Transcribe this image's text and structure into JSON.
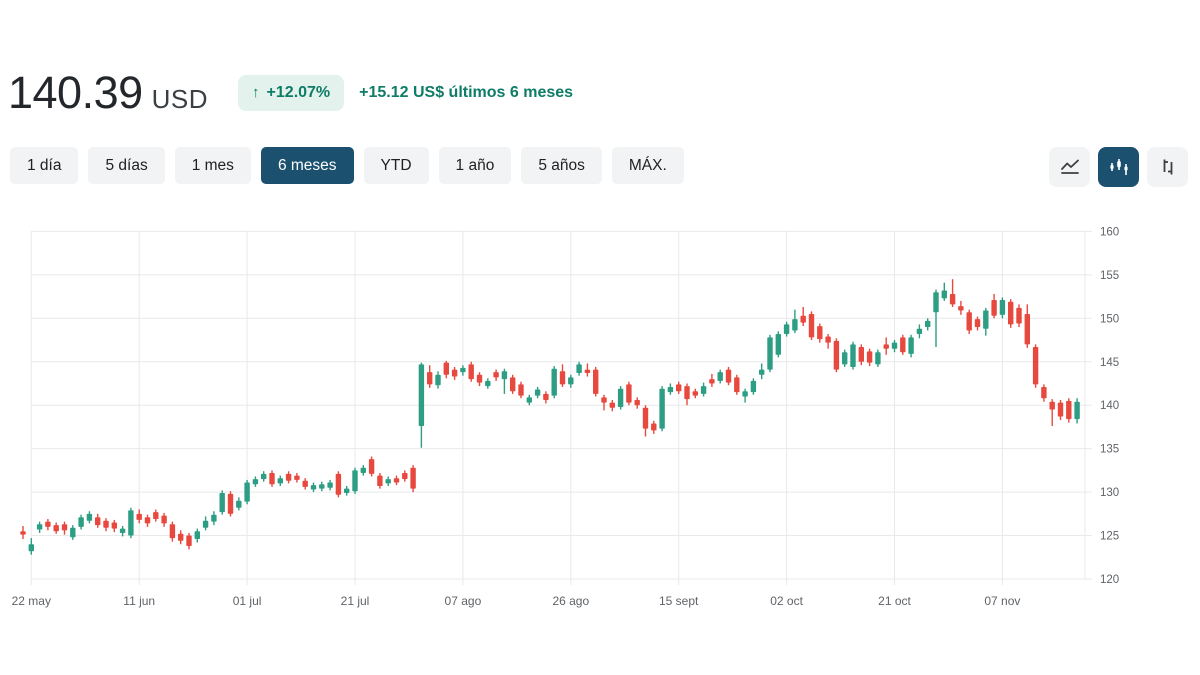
{
  "header": {
    "price": "140.39",
    "currency": "USD",
    "arrow": "↑",
    "change_percent": "+12.07%",
    "change_detail": "+15.12 US$ últimos 6 meses",
    "accent_color": "#0e7c66",
    "badge_bg": "#e3f2ec"
  },
  "tabs": {
    "items": [
      {
        "label": "1 día",
        "selected": false
      },
      {
        "label": "5 días",
        "selected": false
      },
      {
        "label": "1 mes",
        "selected": false
      },
      {
        "label": "6 meses",
        "selected": true
      },
      {
        "label": "YTD",
        "selected": false
      },
      {
        "label": "1 año",
        "selected": false
      },
      {
        "label": "5 años",
        "selected": false
      },
      {
        "label": "MÁX.",
        "selected": false
      }
    ],
    "selected_bg": "#1b506f"
  },
  "chart_controls": {
    "buttons": [
      {
        "icon": "line-chart-icon",
        "selected": false
      },
      {
        "icon": "candlestick-icon",
        "selected": true
      },
      {
        "icon": "ohlc-compare-icon",
        "selected": false
      }
    ]
  },
  "chart_data": {
    "type": "candlestick",
    "title": "",
    "xlabel": "",
    "ylabel": "",
    "ylim": [
      120,
      160
    ],
    "y_ticks": [
      120,
      125,
      130,
      135,
      140,
      145,
      150,
      155,
      160
    ],
    "x_tick_labels": [
      "22 may",
      "11 jun",
      "01 jul",
      "21 jul",
      "07 ago",
      "26 ago",
      "15 sept",
      "02 oct",
      "21 oct",
      "07 nov"
    ],
    "x_tick_indices": [
      1,
      14,
      27,
      40,
      53,
      66,
      79,
      92,
      105,
      118
    ],
    "grid": true,
    "legend": "none",
    "up_color": "#2d9e84",
    "down_color": "#e8493f",
    "axis_text_color": "#5f6368",
    "grid_color": "#e8e9eb",
    "candles_format": "[open, high, low, close]",
    "candles": [
      [
        125.5,
        126.1,
        124.6,
        125.1
      ],
      [
        123.2,
        124.7,
        122.8,
        124.0
      ],
      [
        125.7,
        126.6,
        125.3,
        126.3
      ],
      [
        126.6,
        126.9,
        125.6,
        126.0
      ],
      [
        126.2,
        126.5,
        125.2,
        125.5
      ],
      [
        126.3,
        126.6,
        125.1,
        125.6
      ],
      [
        124.8,
        126.2,
        124.5,
        125.9
      ],
      [
        126.0,
        127.4,
        125.7,
        127.1
      ],
      [
        126.7,
        127.8,
        126.4,
        127.5
      ],
      [
        127.1,
        127.5,
        125.9,
        126.2
      ],
      [
        126.7,
        127.0,
        125.5,
        125.9
      ],
      [
        126.5,
        126.8,
        125.4,
        125.8
      ],
      [
        125.3,
        126.1,
        124.9,
        125.8
      ],
      [
        125.0,
        128.2,
        124.7,
        127.9
      ],
      [
        127.5,
        128.0,
        126.4,
        126.8
      ],
      [
        127.1,
        127.4,
        126.0,
        126.4
      ],
      [
        127.7,
        128.0,
        126.6,
        126.9
      ],
      [
        127.3,
        127.6,
        126.0,
        126.4
      ],
      [
        126.3,
        126.6,
        124.3,
        124.7
      ],
      [
        125.2,
        125.6,
        124.0,
        124.4
      ],
      [
        125.0,
        125.3,
        123.4,
        123.8
      ],
      [
        124.6,
        125.8,
        124.2,
        125.5
      ],
      [
        125.9,
        127.2,
        125.6,
        126.7
      ],
      [
        126.6,
        127.8,
        126.2,
        127.4
      ],
      [
        127.7,
        130.2,
        127.4,
        129.9
      ],
      [
        129.8,
        130.1,
        127.2,
        127.5
      ],
      [
        128.2,
        129.4,
        127.9,
        129.0
      ],
      [
        128.9,
        131.4,
        128.6,
        131.1
      ],
      [
        130.9,
        131.8,
        130.6,
        131.5
      ],
      [
        131.5,
        132.4,
        131.2,
        132.1
      ],
      [
        132.2,
        132.5,
        130.6,
        130.9
      ],
      [
        131.0,
        131.9,
        130.7,
        131.6
      ],
      [
        132.1,
        132.4,
        131.0,
        131.3
      ],
      [
        131.9,
        132.2,
        131.1,
        131.4
      ],
      [
        131.3,
        131.6,
        130.3,
        130.6
      ],
      [
        130.3,
        131.1,
        130.0,
        130.8
      ],
      [
        130.4,
        131.2,
        130.1,
        130.9
      ],
      [
        130.5,
        131.4,
        130.2,
        131.1
      ],
      [
        132.1,
        132.4,
        129.4,
        129.7
      ],
      [
        129.9,
        130.7,
        129.6,
        130.4
      ],
      [
        130.1,
        132.8,
        129.8,
        132.5
      ],
      [
        132.2,
        133.1,
        131.9,
        132.8
      ],
      [
        133.8,
        134.1,
        131.8,
        132.1
      ],
      [
        131.9,
        132.2,
        130.4,
        130.7
      ],
      [
        131.0,
        131.8,
        130.7,
        131.5
      ],
      [
        131.6,
        131.9,
        130.8,
        131.1
      ],
      [
        132.2,
        132.5,
        131.2,
        131.5
      ],
      [
        132.8,
        133.1,
        130.0,
        130.4
      ],
      [
        137.6,
        144.9,
        135.1,
        144.7
      ],
      [
        143.8,
        144.6,
        142.0,
        142.4
      ],
      [
        142.3,
        143.9,
        141.9,
        143.5
      ],
      [
        144.9,
        145.1,
        143.1,
        143.5
      ],
      [
        144.1,
        144.4,
        142.9,
        143.3
      ],
      [
        143.8,
        144.6,
        143.4,
        144.3
      ],
      [
        144.7,
        145.0,
        142.7,
        143.0
      ],
      [
        143.5,
        143.8,
        142.2,
        142.6
      ],
      [
        142.2,
        143.1,
        141.9,
        142.8
      ],
      [
        143.8,
        144.1,
        142.8,
        143.2
      ],
      [
        143.0,
        144.2,
        141.3,
        143.9
      ],
      [
        143.2,
        143.5,
        141.3,
        141.6
      ],
      [
        142.4,
        142.7,
        140.8,
        141.1
      ],
      [
        140.3,
        141.2,
        140.0,
        140.9
      ],
      [
        141.1,
        142.1,
        140.8,
        141.8
      ],
      [
        141.3,
        141.6,
        140.2,
        140.6
      ],
      [
        141.1,
        144.5,
        140.8,
        144.2
      ],
      [
        143.9,
        144.7,
        142.1,
        142.4
      ],
      [
        142.4,
        143.5,
        142.0,
        143.2
      ],
      [
        143.7,
        145.0,
        143.4,
        144.7
      ],
      [
        144.1,
        144.8,
        143.3,
        143.7
      ],
      [
        144.1,
        144.4,
        141.0,
        141.3
      ],
      [
        140.9,
        141.2,
        139.4,
        140.3
      ],
      [
        140.3,
        140.6,
        139.3,
        139.7
      ],
      [
        139.8,
        142.2,
        139.5,
        141.9
      ],
      [
        142.4,
        142.7,
        140.0,
        140.3
      ],
      [
        140.6,
        140.9,
        139.6,
        140.0
      ],
      [
        139.7,
        140.0,
        136.4,
        137.3
      ],
      [
        137.9,
        138.2,
        136.7,
        137.1
      ],
      [
        137.3,
        142.2,
        137.0,
        141.9
      ],
      [
        141.5,
        142.5,
        141.2,
        142.1
      ],
      [
        142.4,
        142.7,
        141.3,
        141.6
      ],
      [
        142.2,
        142.5,
        140.0,
        140.7
      ],
      [
        141.6,
        141.9,
        140.8,
        141.1
      ],
      [
        141.3,
        142.6,
        141.0,
        142.2
      ],
      [
        143.0,
        143.6,
        142.1,
        142.5
      ],
      [
        142.8,
        144.1,
        142.5,
        143.8
      ],
      [
        144.1,
        144.4,
        142.3,
        142.6
      ],
      [
        143.2,
        143.5,
        141.2,
        141.5
      ],
      [
        141.0,
        141.9,
        140.3,
        141.6
      ],
      [
        141.5,
        143.1,
        141.2,
        142.8
      ],
      [
        143.5,
        144.8,
        143.0,
        144.1
      ],
      [
        144.1,
        148.1,
        143.8,
        147.8
      ],
      [
        145.8,
        148.5,
        145.5,
        148.2
      ],
      [
        148.2,
        149.6,
        147.9,
        149.3
      ],
      [
        148.6,
        151.0,
        148.3,
        149.9
      ],
      [
        150.3,
        151.3,
        149.1,
        149.5
      ],
      [
        150.5,
        150.8,
        147.5,
        147.8
      ],
      [
        149.1,
        149.4,
        147.2,
        147.6
      ],
      [
        147.9,
        148.2,
        146.5,
        147.2
      ],
      [
        147.4,
        147.7,
        143.8,
        144.1
      ],
      [
        144.7,
        146.4,
        144.4,
        146.1
      ],
      [
        144.4,
        147.3,
        144.1,
        147.0
      ],
      [
        146.7,
        147.0,
        144.6,
        145.0
      ],
      [
        146.2,
        146.5,
        144.5,
        144.9
      ],
      [
        144.7,
        146.4,
        144.4,
        146.1
      ],
      [
        147.0,
        147.8,
        145.8,
        146.5
      ],
      [
        146.5,
        147.5,
        146.1,
        147.2
      ],
      [
        147.8,
        148.1,
        145.8,
        146.1
      ],
      [
        145.9,
        148.1,
        145.5,
        147.8
      ],
      [
        148.2,
        149.3,
        147.7,
        148.8
      ],
      [
        149.0,
        150.0,
        148.6,
        149.7
      ],
      [
        150.7,
        153.3,
        146.7,
        153.0
      ],
      [
        152.3,
        154.1,
        152.0,
        153.2
      ],
      [
        152.8,
        154.5,
        151.3,
        151.6
      ],
      [
        151.4,
        152.0,
        150.4,
        150.9
      ],
      [
        150.7,
        151.0,
        148.2,
        148.6
      ],
      [
        149.9,
        150.2,
        148.6,
        149.0
      ],
      [
        148.8,
        151.2,
        148.0,
        150.9
      ],
      [
        152.1,
        152.8,
        150.0,
        150.3
      ],
      [
        150.4,
        152.4,
        150.0,
        152.1
      ],
      [
        151.9,
        152.2,
        148.9,
        149.3
      ],
      [
        151.2,
        151.6,
        149.0,
        149.4
      ],
      [
        150.5,
        151.6,
        146.6,
        147.0
      ],
      [
        146.7,
        147.0,
        142.0,
        142.4
      ],
      [
        142.1,
        142.4,
        140.4,
        140.8
      ],
      [
        140.4,
        140.7,
        137.6,
        139.5
      ],
      [
        140.3,
        140.6,
        138.3,
        138.7
      ],
      [
        140.5,
        140.8,
        138.0,
        138.4
      ],
      [
        138.4,
        140.8,
        137.9,
        140.4
      ]
    ]
  }
}
